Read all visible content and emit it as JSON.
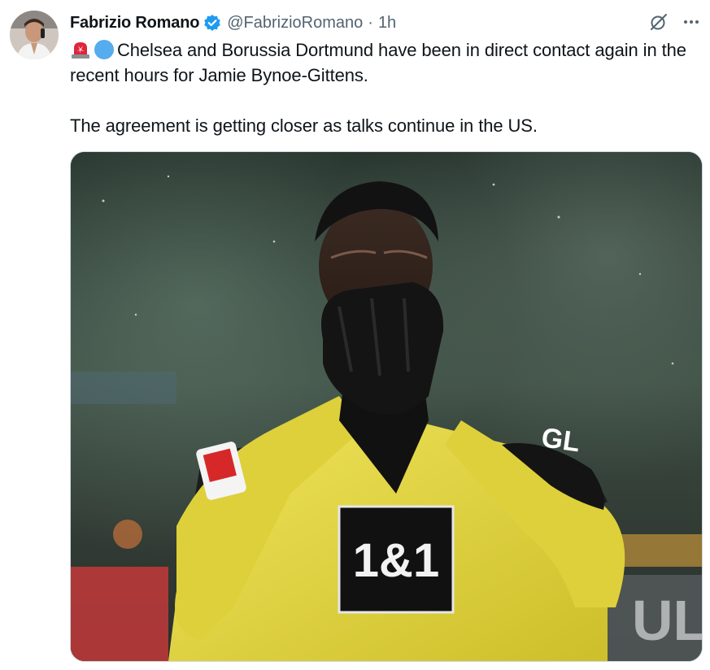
{
  "author": {
    "name": "Fabrizio Romano",
    "handle": "@FabrizioRomano",
    "separator": "·",
    "time": "1h"
  },
  "tweet": {
    "emojis": [
      "police-light-emoji",
      "blue-circle-emoji"
    ],
    "line1": "Chelsea and Borussia Dortmund have been in direct contact again in the recent hours for Jamie Bynoe-Gittens.",
    "line2": "The agreement is getting closer as talks continue in the US."
  },
  "media": {
    "sponsor": "1&1",
    "sleeve_sponsor": "GL",
    "badge": "BUNDESLIGA"
  },
  "colors": {
    "verified": "#1d9bf0",
    "text": "#0f1419",
    "muted": "#536471",
    "kit_yellow": "#e6d83a"
  }
}
